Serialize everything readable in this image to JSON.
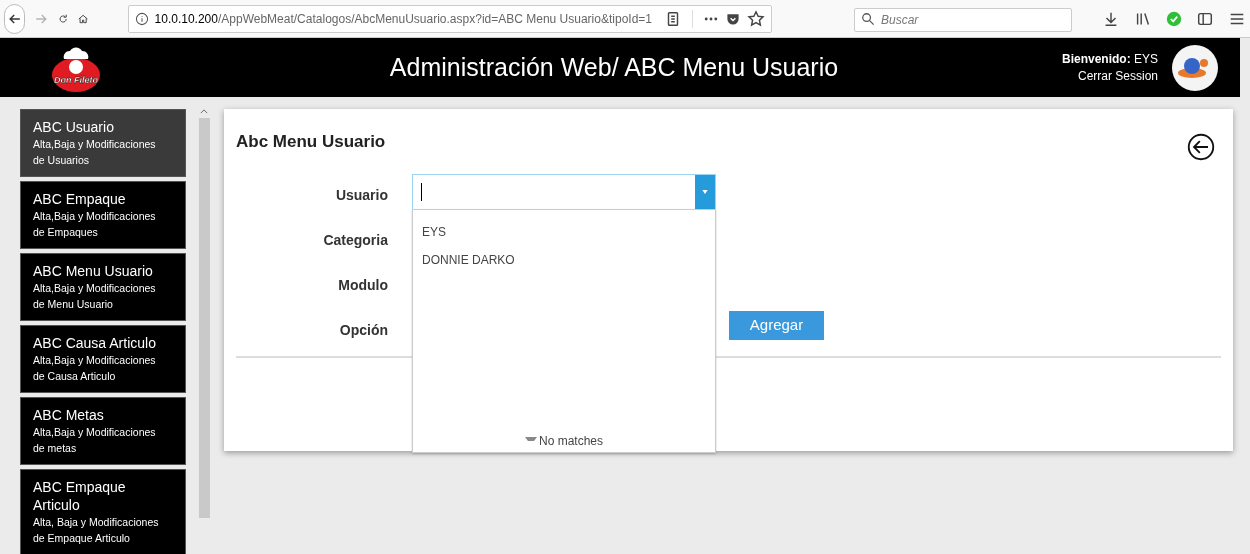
{
  "browser": {
    "url_host": "10.0.10.200",
    "url_path": "/AppWebMeat/Catalogos/AbcMenuUsuario.aspx?id=ABC Menu Usuario&tipoId=1",
    "search": {
      "placeholder": "Buscar"
    },
    "forward_disabled": true
  },
  "header": {
    "logo_text": "Don Fileto",
    "title": "Administración Web/ ABC Menu Usuario",
    "welcome_label": "Bienvenido:",
    "user": "EYS",
    "logout": "Cerrar Session"
  },
  "sidebar": {
    "items": [
      {
        "title": "ABC Usuario",
        "subtitle": "Alta,Baja y Modificaciones de Usuarios",
        "selected": true
      },
      {
        "title": "ABC Empaque",
        "subtitle": "Alta,Baja y Modificaciones de Empaques",
        "selected": false
      },
      {
        "title": "ABC Menu Usuario",
        "subtitle": "Alta,Baja y Modificaciones de Menu Usuario",
        "selected": false
      },
      {
        "title": "ABC Causa Articulo",
        "subtitle": "Alta,Baja y Modificaciones de Causa Articulo",
        "selected": false
      },
      {
        "title": "ABC Metas",
        "subtitle": "Alta,Baja y Modificaciones de metas",
        "selected": false
      },
      {
        "title": "ABC Empaque Articulo",
        "subtitle": "Alta, Baja y Modificaciones de Empaque Articulo",
        "selected": false
      }
    ]
  },
  "card": {
    "title": "Abc Menu Usuario",
    "fields": [
      {
        "label": "Usuario"
      },
      {
        "label": "Categoria"
      },
      {
        "label": "Modulo"
      },
      {
        "label": "Opción"
      }
    ],
    "add_button": "Agregar",
    "dropdown": {
      "expanded": true,
      "options": [
        "EYS",
        "DONNIE DARKO"
      ],
      "empty_message": "No matches"
    }
  }
}
